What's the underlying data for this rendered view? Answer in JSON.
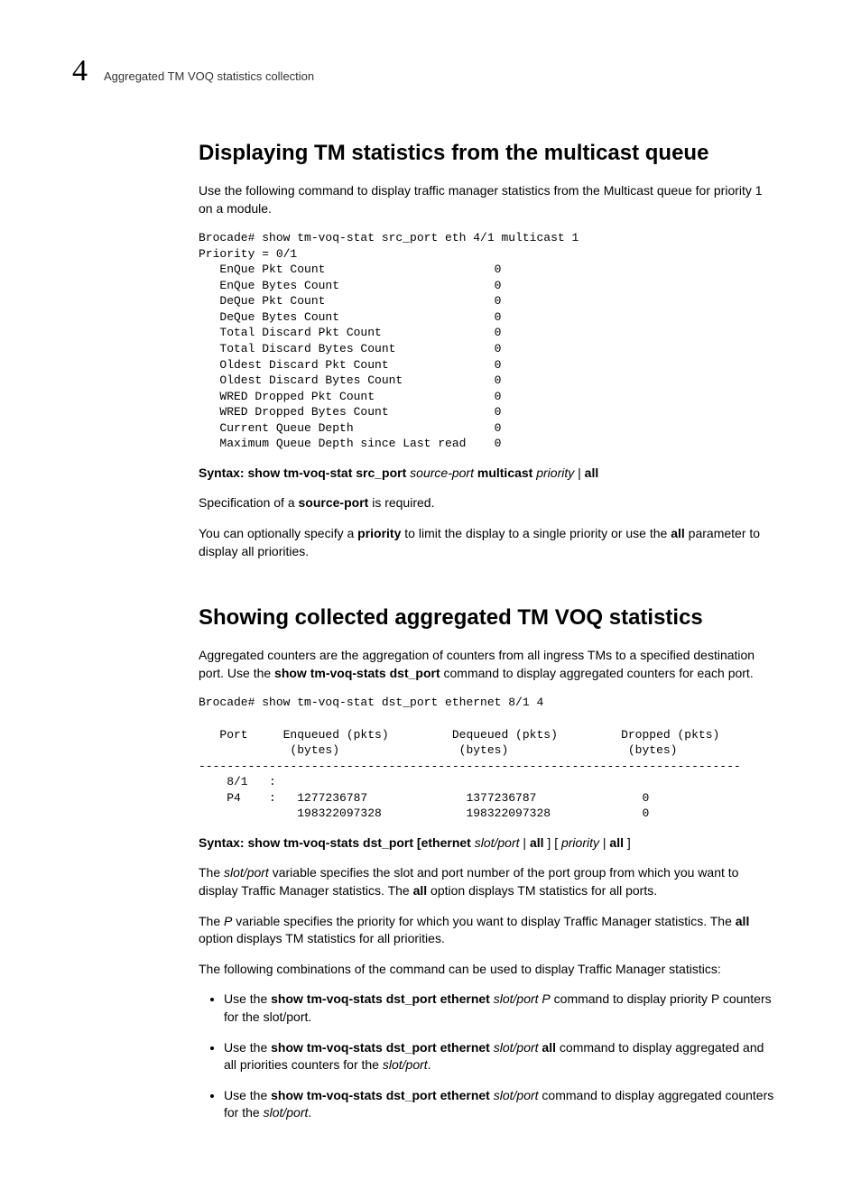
{
  "header": {
    "chapter": "4",
    "path": "Aggregated TM VOQ statistics collection"
  },
  "s1": {
    "heading": "Displaying TM statistics from the multicast queue",
    "intro": "Use the following command to display traffic manager statistics from the Multicast queue for priority 1 on a module.",
    "code": "Brocade# show tm-voq-stat src_port eth 4/1 multicast 1\nPriority = 0/1\n   EnQue Pkt Count                        0\n   EnQue Bytes Count                      0\n   DeQue Pkt Count                        0\n   DeQue Bytes Count                      0\n   Total Discard Pkt Count                0\n   Total Discard Bytes Count              0\n   Oldest Discard Pkt Count               0\n   Oldest Discard Bytes Count             0\n   WRED Dropped Pkt Count                 0\n   WRED Dropped Bytes Count               0\n   Current Queue Depth                    0\n   Maximum Queue Depth since Last read    0",
    "syntax": {
      "prefix": "Syntax:",
      "cmd1": " show tm-voq-stat src_port ",
      "arg1": "source-port",
      "cmd2": " multicast ",
      "arg2": "priority",
      "sep": " | ",
      "cmd3": "all"
    },
    "spec1a": "Specification of a ",
    "spec1b": "source-port",
    "spec1c": " is required.",
    "spec2a": "You can optionally specify a ",
    "spec2b": "priority",
    "spec2c": " to limit the display to a single priority or use the ",
    "spec2d": "all",
    "spec2e": " parameter to display all priorities."
  },
  "s2": {
    "heading": "Showing collected aggregated TM VOQ statistics",
    "p1a": "Aggregated counters are the aggregation of counters from all ingress TMs to a specified destination port. Use the ",
    "p1b": "show tm-voq-stats dst_port",
    "p1c": " command to display aggregated counters for each port.",
    "code": "Brocade# show tm-voq-stat dst_port ethernet 8/1 4\n\n   Port     Enqueued (pkts)         Dequeued (pkts)         Dropped (pkts)\n             (bytes)                 (bytes)                 (bytes)\n-----------------------------------------------------------------------------\n    8/1   :\n    P4    :   1277236787              1377236787               0\n              198322097328            198322097328             0",
    "syntax": {
      "prefix": "Syntax:",
      "cmd1": " show tm-voq-stats dst_port [ethernet ",
      "arg1": "slot/port",
      "sep1": " | ",
      "cmd2": "all",
      "mid": " ] [ ",
      "arg2": "priority",
      "sep2": " | ",
      "cmd3": "all",
      "end": " ]"
    },
    "p2a": "The ",
    "p2b": "slot/port",
    "p2c": " variable specifies the slot and port number of the port group from which you want to display Traffic Manager statistics. The ",
    "p2d": "all",
    "p2e": " option displays TM statistics for all ports.",
    "p3a": "The ",
    "p3b": "P",
    "p3c": " variable specifies the priority for which you want to display Traffic Manager statistics. The ",
    "p3d": "all",
    "p3e": " option displays TM statistics for all priorities.",
    "p4": "The following combinations of the command can be used to display Traffic Manager statistics:",
    "b1a": "Use the ",
    "b1b": "show tm-voq-stats dst_port ethernet ",
    "b1c": "slot/port P",
    "b1d": " command to display priority P counters for the slot/port.",
    "b2a": "Use the ",
    "b2b": "show tm-voq-stats dst_port ethernet ",
    "b2c": "slot/port",
    "b2d": " all",
    "b2e": " command to display aggregated and all priorities counters for the ",
    "b2f": "slot/port",
    "b2g": ".",
    "b3a": "Use the ",
    "b3b": "show tm-voq-stats dst_port ethernet ",
    "b3c": "slot/port",
    "b3d": " command to display aggregated counters for the ",
    "b3e": "slot/port",
    "b3f": "."
  }
}
